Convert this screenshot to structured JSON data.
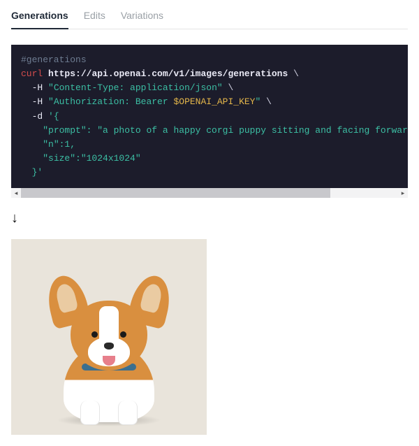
{
  "tabs": [
    {
      "label": "Generations",
      "active": true
    },
    {
      "label": "Edits",
      "active": false
    },
    {
      "label": "Variations",
      "active": false
    }
  ],
  "code": {
    "l1_comment": "#generations",
    "l2_cmd": "curl",
    "l2_url": "https://api.openai.com/v1/images/generations",
    "l3_flag": "-H",
    "l3_str": "\"Content-Type: application/json\"",
    "l4_flag": "-H",
    "l4_str_a": "\"Authorization: Bearer ",
    "l4_var": "$OPENAI_API_KEY",
    "l4_str_b": "\"",
    "l5_flag": "-d",
    "l5_str": "'{",
    "l6_str": "\"prompt\": \"a photo of a happy corgi puppy sitting and facing forward, studio light",
    "l7_str": "\"n\":1,",
    "l8_str": "\"size\":\"1024x1024\"",
    "l9_str": "}'",
    "bs": "\\"
  },
  "arrow_glyph": "↓",
  "result": {
    "desc": "corgi-puppy-result-image"
  }
}
